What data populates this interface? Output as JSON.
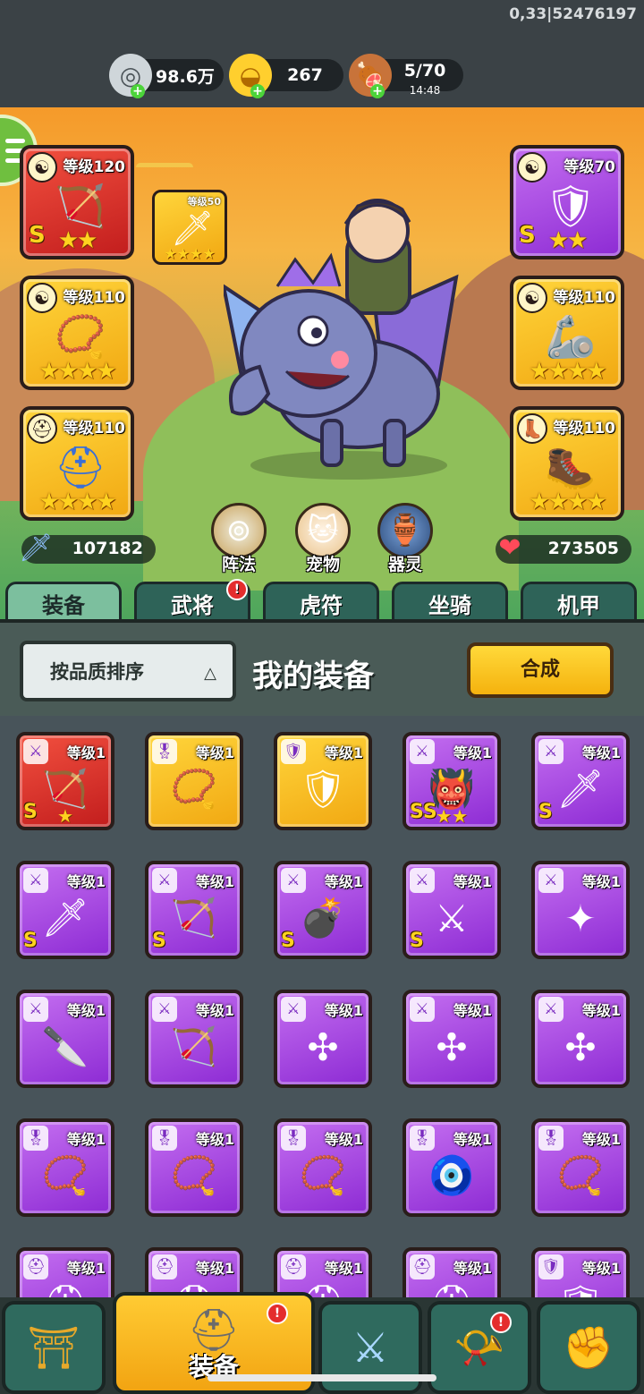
{
  "debug_text": "0,33|52476197",
  "resources": [
    {
      "name": "silver",
      "icon": "coin-icon",
      "value": "98.6万"
    },
    {
      "name": "gold",
      "icon": "gold-ingot-icon",
      "value": "267"
    },
    {
      "name": "stamina",
      "icon": "meat-icon",
      "value": "5/70",
      "timer": "14:48"
    }
  ],
  "equip_slots": [
    {
      "level": "等级120",
      "quality": "red",
      "badge": "yin-yang-icon",
      "rank": "S",
      "stars": "★★"
    },
    {
      "level": "等级110",
      "quality": "gold",
      "badge": "yin-yang-icon",
      "rank": "",
      "stars": "★★★★"
    },
    {
      "level": "等级110",
      "quality": "gold",
      "badge": "helmet-icon",
      "rank": "",
      "stars": "★★★★"
    },
    {
      "level": "等级70",
      "quality": "purple",
      "badge": "yin-yang-icon",
      "rank": "S",
      "stars": "★★"
    },
    {
      "level": "等级110",
      "quality": "gold",
      "badge": "yin-yang-icon",
      "rank": "",
      "stars": "★★★★"
    },
    {
      "level": "等级110",
      "quality": "gold",
      "badge": "boot-icon",
      "rank": "",
      "stars": "★★★★"
    }
  ],
  "mini_slot": {
    "level": "等级50",
    "stars": "★★★★"
  },
  "attack": "107182",
  "hp": "273505",
  "circle_buttons": [
    {
      "label": "阵法",
      "icon": "formation-icon"
    },
    {
      "label": "宠物",
      "icon": "pet-cat-icon"
    },
    {
      "label": "器灵",
      "icon": "spirit-icon"
    }
  ],
  "tabs": [
    "装备",
    "武将",
    "虎符",
    "坐骑",
    "机甲"
  ],
  "tab_notice": "!",
  "sort_label": "按品质排序",
  "panel_title": "我的装备",
  "merge_label": "合成",
  "item_level": "等级1",
  "items": [
    {
      "q": "red",
      "badge": "sword-icon",
      "rank": "S",
      "stars": "★",
      "art": "crossbow-icon"
    },
    {
      "q": "gold",
      "badge": "medal-icon",
      "rank": "",
      "stars": "",
      "art": "amulet-icon"
    },
    {
      "q": "gold",
      "badge": "armor-icon",
      "rank": "",
      "stars": "",
      "art": "armor-icon"
    },
    {
      "q": "purple",
      "badge": "sword-icon",
      "rank": "SS",
      "stars": "★★",
      "art": "mask-icon"
    },
    {
      "q": "purple",
      "badge": "sword-icon",
      "rank": "S",
      "stars": "",
      "art": "blade-icon"
    },
    {
      "q": "purple",
      "badge": "sword-icon",
      "rank": "S",
      "stars": "",
      "art": "ice-sword-icon"
    },
    {
      "q": "purple",
      "badge": "sword-icon",
      "rank": "S",
      "stars": "",
      "art": "crossbow-icon"
    },
    {
      "q": "purple",
      "badge": "sword-icon",
      "rank": "S",
      "stars": "",
      "art": "bomb-icon"
    },
    {
      "q": "purple",
      "badge": "sword-icon",
      "rank": "S",
      "stars": "",
      "art": "dual-swords-icon"
    },
    {
      "q": "purple",
      "badge": "sword-icon",
      "rank": "",
      "stars": "",
      "art": "shuriken-icon"
    },
    {
      "q": "purple",
      "badge": "sword-icon",
      "rank": "",
      "stars": "",
      "art": "dagger-icon"
    },
    {
      "q": "purple",
      "badge": "sword-icon",
      "rank": "",
      "stars": "",
      "art": "bow-icon"
    },
    {
      "q": "purple",
      "badge": "sword-icon",
      "rank": "",
      "stars": "",
      "art": "triblade-icon"
    },
    {
      "q": "purple",
      "badge": "sword-icon",
      "rank": "",
      "stars": "",
      "art": "triblade-icon"
    },
    {
      "q": "purple",
      "badge": "sword-icon",
      "rank": "",
      "stars": "",
      "art": "triblade-icon"
    },
    {
      "q": "purple",
      "badge": "medal-icon",
      "rank": "",
      "stars": "",
      "art": "amulet-icon"
    },
    {
      "q": "purple",
      "badge": "medal-icon",
      "rank": "",
      "stars": "",
      "art": "amulet-icon"
    },
    {
      "q": "purple",
      "badge": "medal-icon",
      "rank": "",
      "stars": "",
      "art": "amulet-icon"
    },
    {
      "q": "purple",
      "badge": "medal-icon",
      "rank": "",
      "stars": "",
      "art": "talisman-icon"
    },
    {
      "q": "purple",
      "badge": "medal-icon",
      "rank": "",
      "stars": "",
      "art": "necklace-icon"
    },
    {
      "q": "purple",
      "badge": "helmet-icon",
      "rank": "",
      "stars": "",
      "art": "helmet-icon"
    },
    {
      "q": "purple",
      "badge": "helmet-icon",
      "rank": "",
      "stars": "",
      "art": "helmet-icon"
    },
    {
      "q": "purple",
      "badge": "helmet-icon",
      "rank": "",
      "stars": "",
      "art": "helmet-icon"
    },
    {
      "q": "purple",
      "badge": "helmet-icon",
      "rank": "",
      "stars": "",
      "art": "helmet-icon"
    },
    {
      "q": "purple",
      "badge": "armor-icon",
      "rank": "",
      "stars": "",
      "art": "armor-icon"
    }
  ],
  "bottom_nav": [
    {
      "icon": "gate-icon",
      "label": ""
    },
    {
      "icon": "equipment-helmet-icon",
      "label": "装备"
    },
    {
      "icon": "crossed-swords-icon",
      "label": ""
    },
    {
      "icon": "horn-icon",
      "label": ""
    },
    {
      "icon": "fist-upgrade-icon",
      "label": ""
    }
  ],
  "nav_notice": "!"
}
